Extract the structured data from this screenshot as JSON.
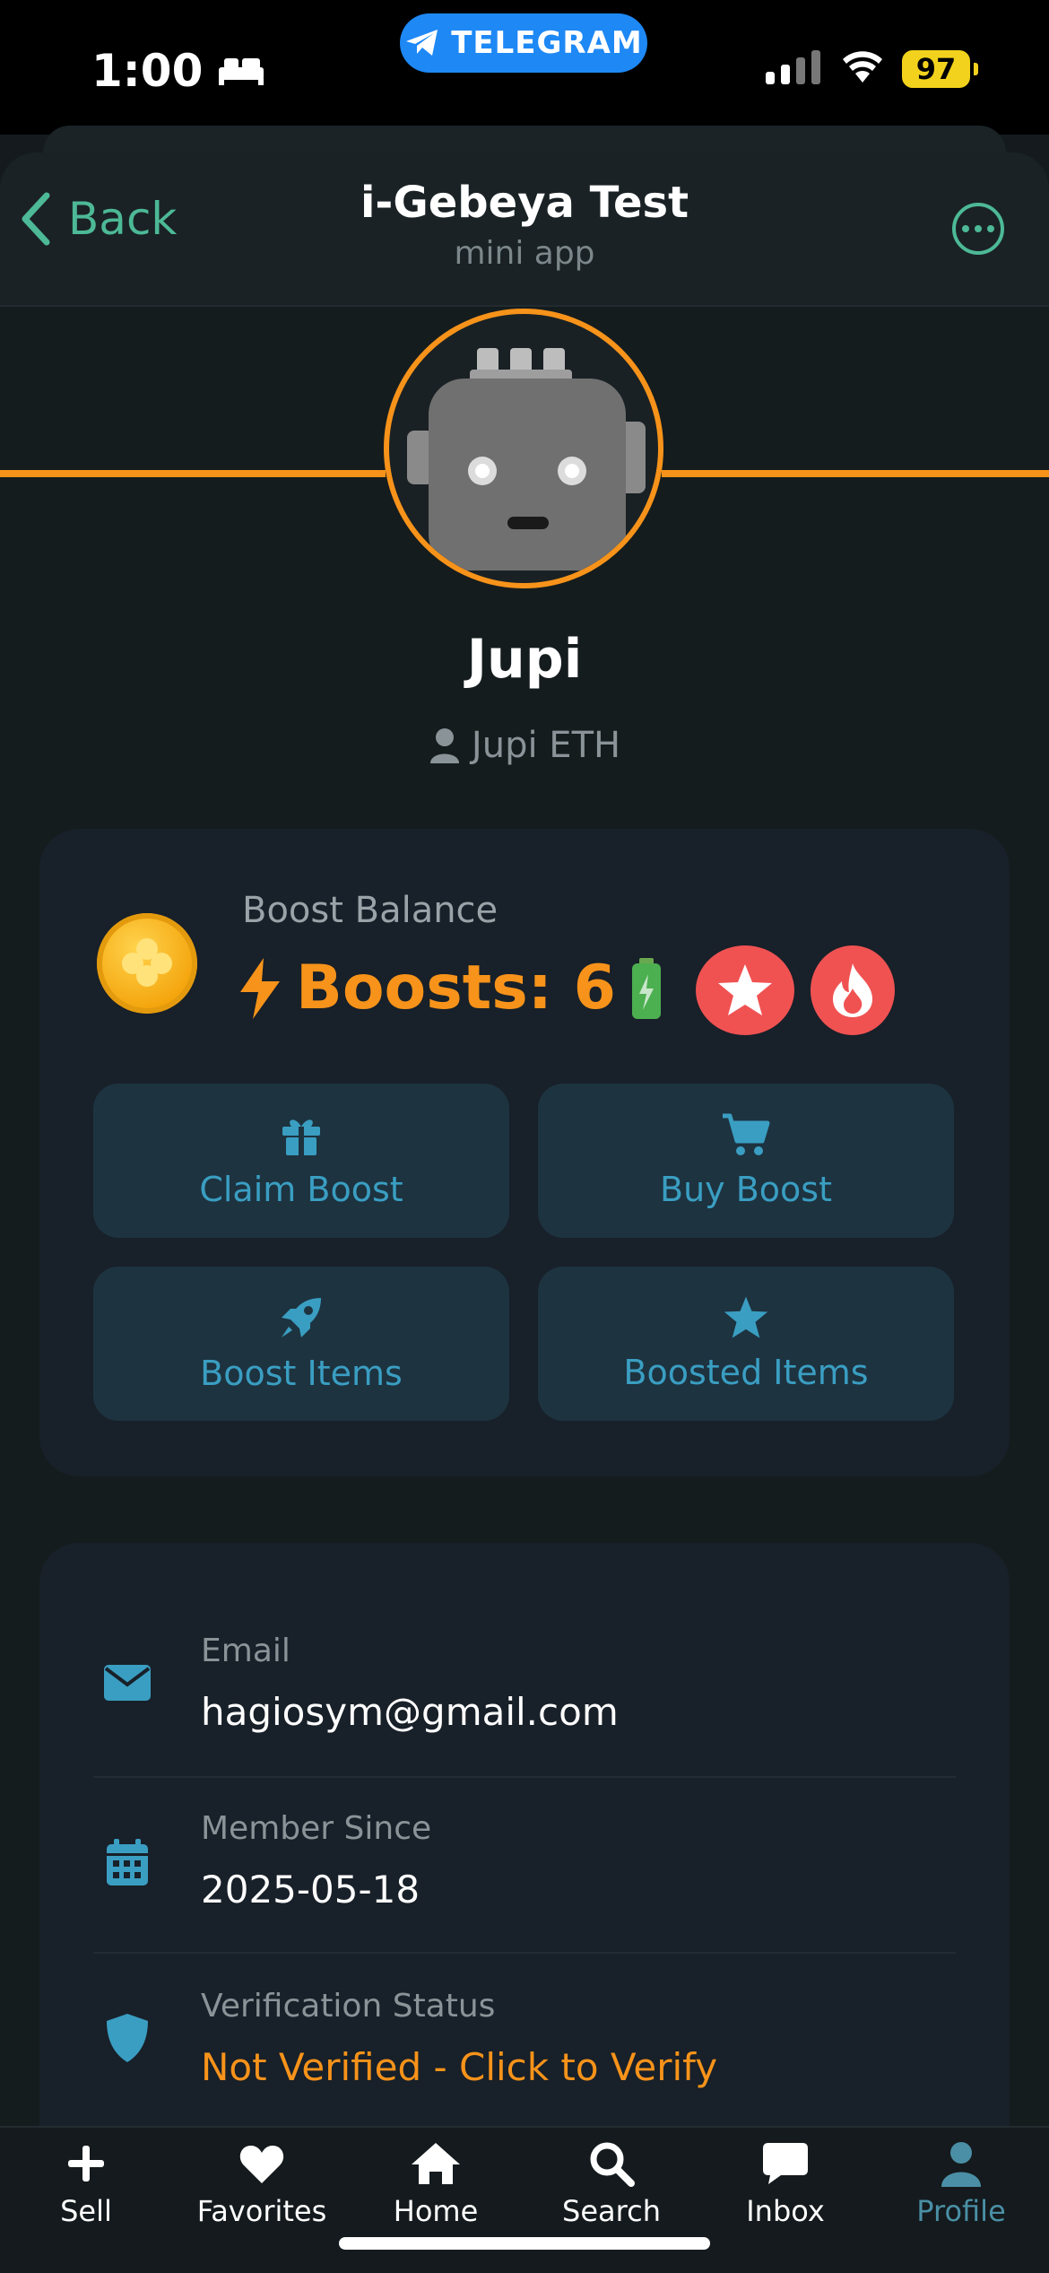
{
  "status_bar": {
    "time": "1:00",
    "telegram_pill": "TELEGRAM",
    "battery": "97"
  },
  "header": {
    "back_label": "Back",
    "title": "i-Gebeya Test",
    "subtitle": "mini app"
  },
  "profile": {
    "name": "Jupi",
    "handle": "Jupi ETH"
  },
  "boost": {
    "balance_label": "Boost Balance",
    "value_text": "Boosts: 6",
    "tiles": [
      {
        "label": "Claim Boost",
        "icon": "gift-icon"
      },
      {
        "label": "Buy Boost",
        "icon": "cart-icon"
      },
      {
        "label": "Boost Items",
        "icon": "rocket-icon"
      },
      {
        "label": "Boosted Items",
        "icon": "star-icon"
      }
    ]
  },
  "info": {
    "email_label": "Email",
    "email_value": "hagiosym@gmail.com",
    "member_label": "Member Since",
    "member_value": "2025-05-18",
    "verification_label": "Verification Status",
    "verification_value": "Not Verified - Click to Verify"
  },
  "nav": {
    "items": [
      {
        "label": "Sell",
        "icon": "plus-icon"
      },
      {
        "label": "Favorites",
        "icon": "heart-icon"
      },
      {
        "label": "Home",
        "icon": "home-icon"
      },
      {
        "label": "Search",
        "icon": "search-icon"
      },
      {
        "label": "Inbox",
        "icon": "chat-icon"
      },
      {
        "label": "Profile",
        "icon": "user-icon"
      }
    ]
  },
  "colors": {
    "accent_green": "#4db996",
    "accent_orange": "#f7931a",
    "tile_blue": "#3a9ec2",
    "badge_red": "#f05252",
    "profile_active": "#4a8fa5"
  }
}
